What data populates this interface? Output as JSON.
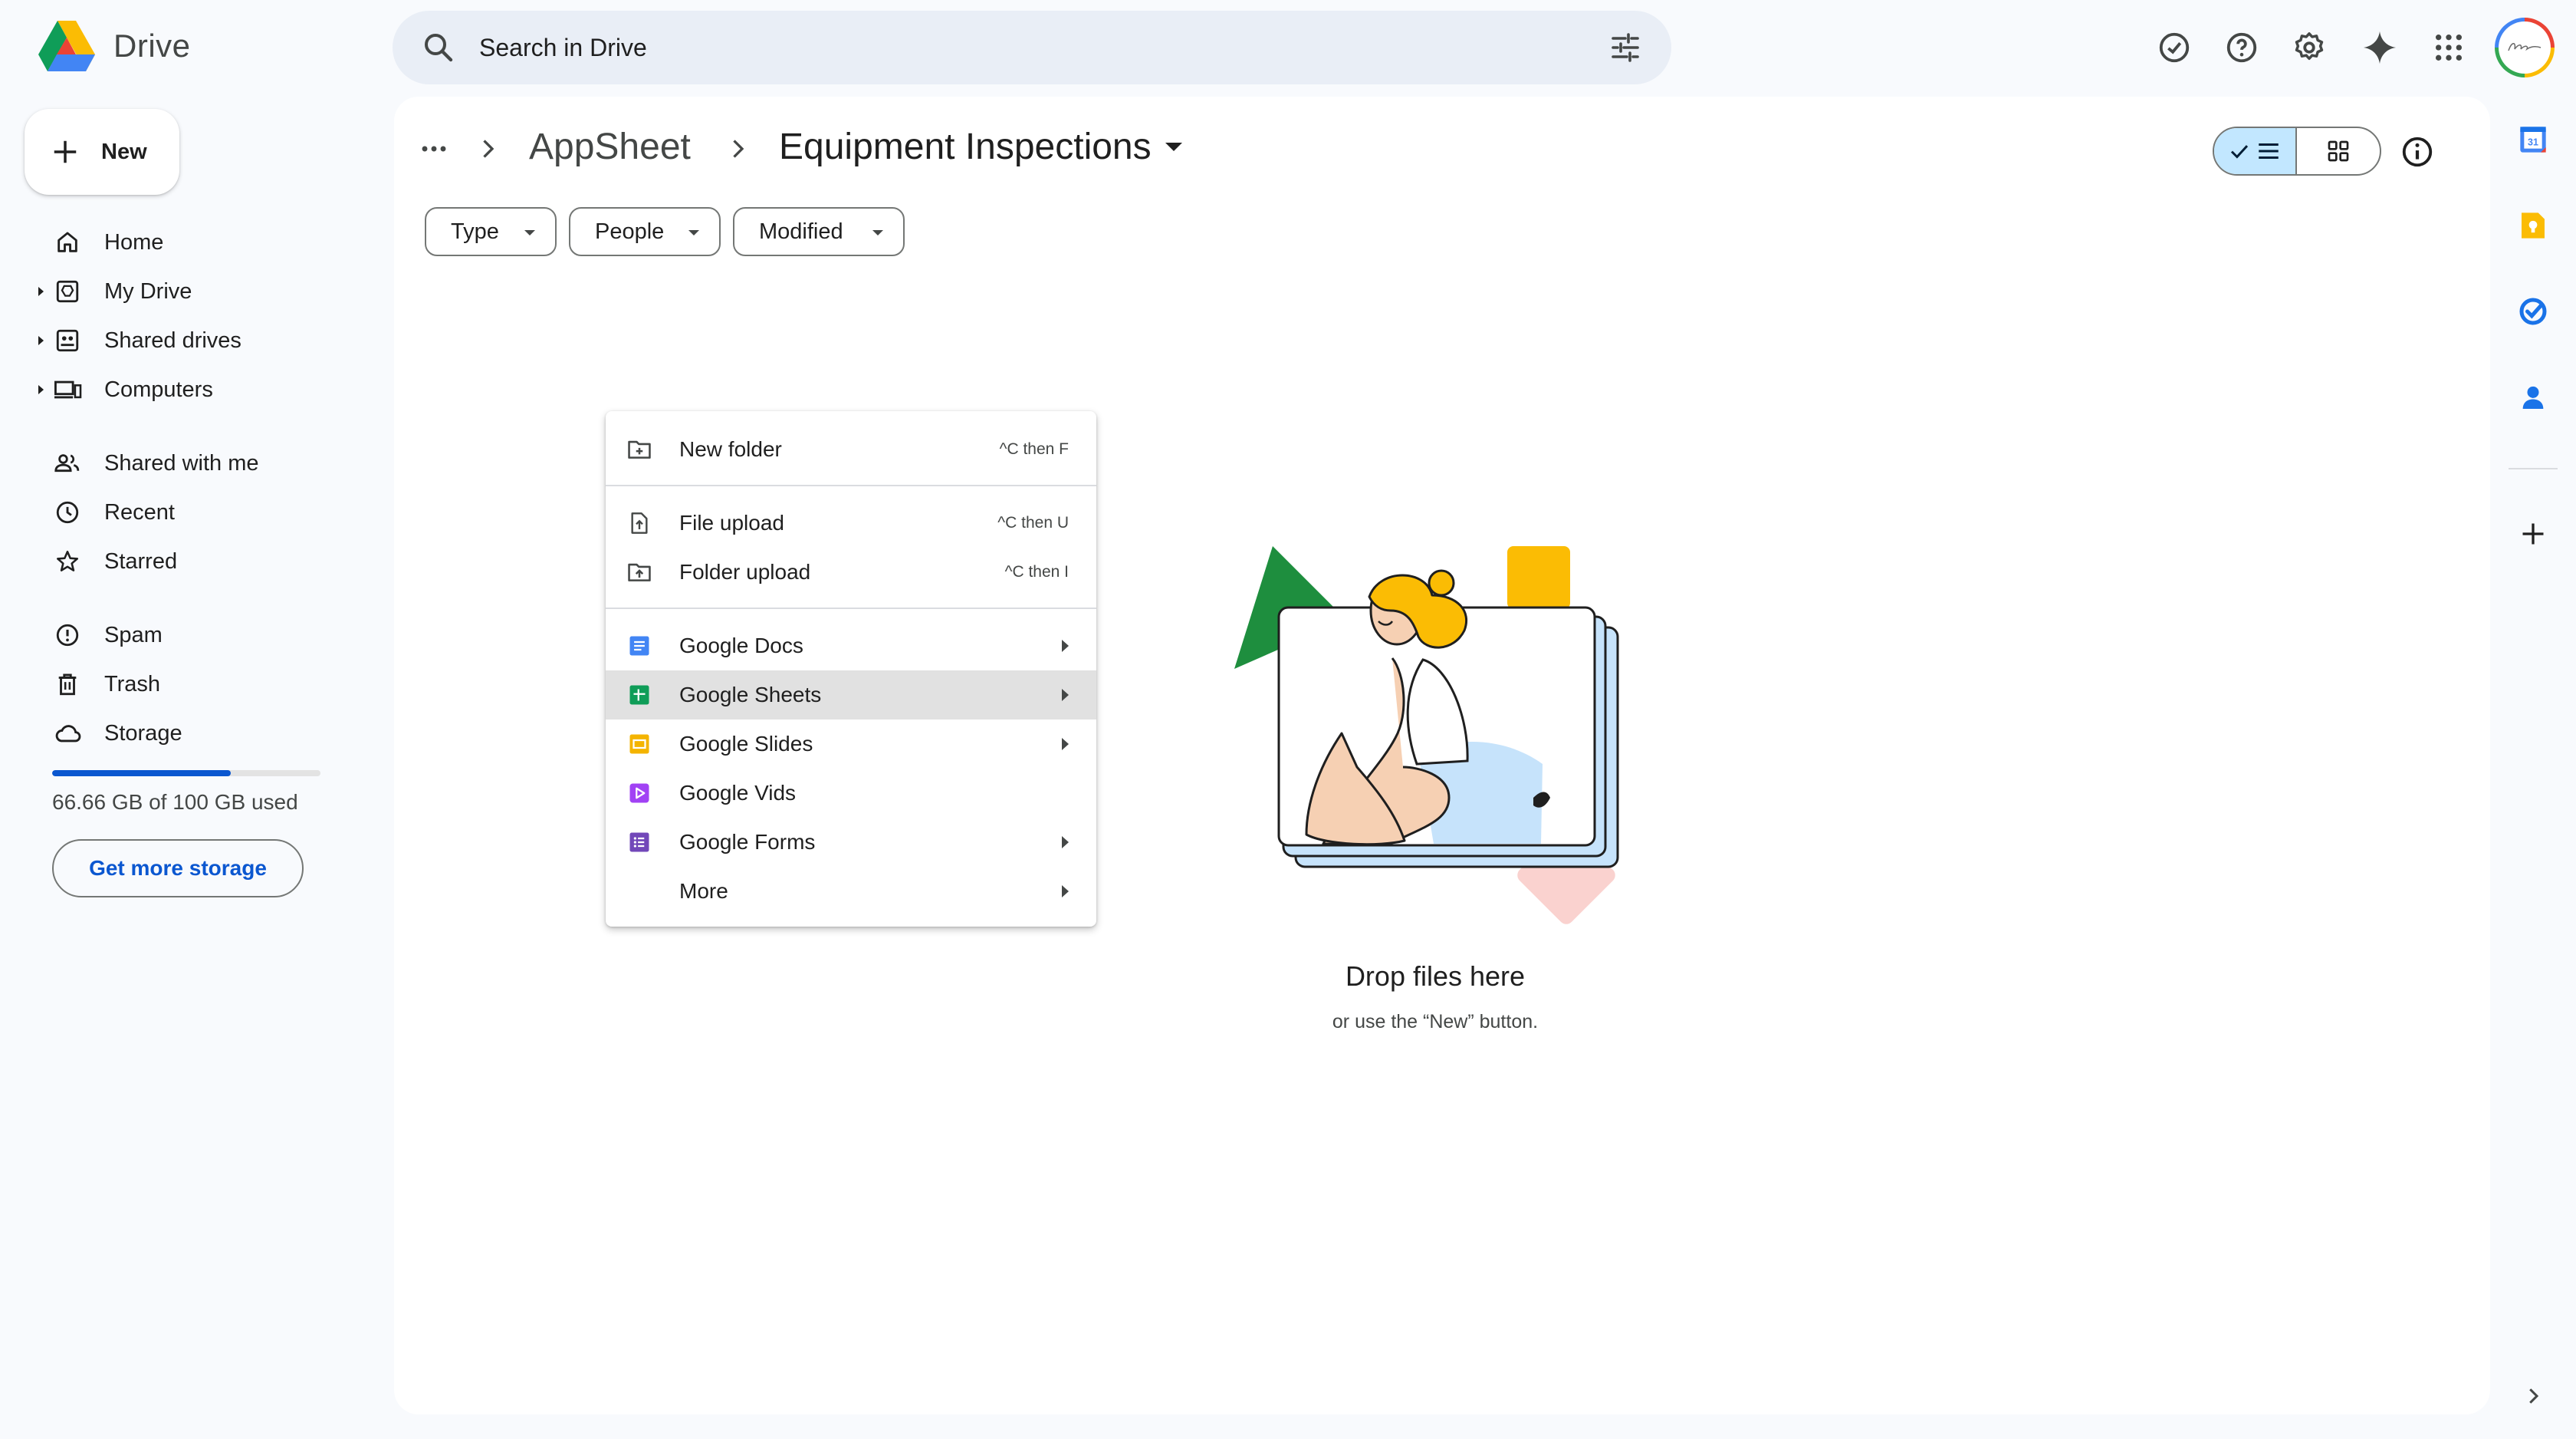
{
  "app": {
    "name": "Drive"
  },
  "search": {
    "placeholder": "Search in Drive"
  },
  "header_icons": [
    "ready-offline-icon",
    "help-icon",
    "settings-icon",
    "gemini-icon",
    "apps-grid-icon",
    "account-avatar"
  ],
  "sidebar": {
    "new_label": "New",
    "items": [
      {
        "label": "Home",
        "icon": "home-icon"
      },
      {
        "label": "My Drive",
        "icon": "my-drive-icon"
      },
      {
        "label": "Shared drives",
        "icon": "shared-drives-icon"
      },
      {
        "label": "Computers",
        "icon": "computers-icon"
      },
      {
        "label": "Shared with me",
        "icon": "people-icon"
      },
      {
        "label": "Recent",
        "icon": "clock-icon"
      },
      {
        "label": "Starred",
        "icon": "star-icon"
      },
      {
        "label": "Spam",
        "icon": "spam-icon"
      },
      {
        "label": "Trash",
        "icon": "trash-icon"
      },
      {
        "label": "Storage",
        "icon": "cloud-icon"
      }
    ],
    "storage": {
      "used_text": "66.66 GB of 100 GB used",
      "used_fraction": 0.6666,
      "cta": "Get more storage"
    }
  },
  "breadcrumb": {
    "parent": "AppSheet",
    "current": "Equipment Inspections"
  },
  "filters": [
    "Type",
    "People",
    "Modified"
  ],
  "view": {
    "active": "list"
  },
  "context_menu": {
    "items": [
      {
        "label": "New folder",
        "shortcut": "^C then F",
        "icon": "new-folder-icon"
      },
      {
        "label": "File upload",
        "shortcut": "^C then U",
        "icon": "file-upload-icon"
      },
      {
        "label": "Folder upload",
        "shortcut": "^C then I",
        "icon": "folder-upload-icon"
      },
      {
        "label": "Google Docs",
        "icon": "google-docs-icon",
        "submenu": true
      },
      {
        "label": "Google Sheets",
        "icon": "google-sheets-icon",
        "submenu": true,
        "highlighted": true
      },
      {
        "label": "Google Slides",
        "icon": "google-slides-icon",
        "submenu": true
      },
      {
        "label": "Google Vids",
        "icon": "google-vids-icon",
        "submenu": false
      },
      {
        "label": "Google Forms",
        "icon": "google-forms-icon",
        "submenu": true
      },
      {
        "label": "More",
        "icon": "",
        "submenu": true
      }
    ]
  },
  "empty_state": {
    "title": "Drop files here",
    "subtitle": "or use the “New” button."
  },
  "right_rail": [
    "calendar-icon",
    "keep-icon",
    "tasks-icon",
    "contacts-icon",
    "add-icon",
    "expand-panel-icon"
  ],
  "colors": {
    "accent": "#0b57d0",
    "selected_view": "#c2e7ff",
    "search_bg": "#e9eef6",
    "page_bg": "#f8fafd"
  }
}
